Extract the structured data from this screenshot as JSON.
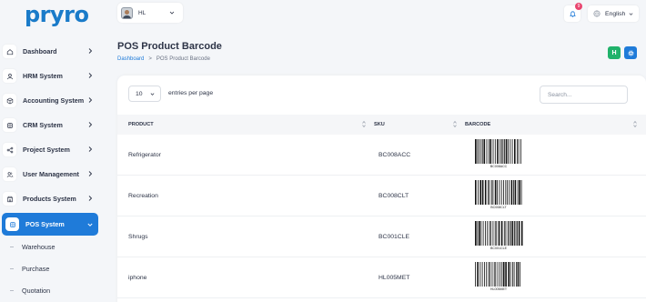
{
  "app": {
    "logo": "pryro"
  },
  "sidebar": {
    "items": [
      {
        "label": "Dashboard",
        "icon": "home-icon"
      },
      {
        "label": "HRM System",
        "icon": "user-icon"
      },
      {
        "label": "Accounting System",
        "icon": "box-icon"
      },
      {
        "label": "CRM System",
        "icon": "layers-icon"
      },
      {
        "label": "Project System",
        "icon": "share-icon"
      },
      {
        "label": "User Management",
        "icon": "users-icon"
      },
      {
        "label": "Products System",
        "icon": "store-icon"
      },
      {
        "label": "POS System",
        "icon": "layers-icon",
        "active": true
      }
    ],
    "subitems": [
      {
        "label": "Warehouse"
      },
      {
        "label": "Purchase"
      },
      {
        "label": "Quotation"
      }
    ]
  },
  "topbar": {
    "user_name": "HL",
    "notification_count": "9",
    "language": "English"
  },
  "header": {
    "title": "POS Product Barcode",
    "breadcrumb": {
      "home": "Dashboard",
      "separator": ">",
      "current": "POS Product Barcode"
    },
    "buttons": {
      "h_label": "H"
    }
  },
  "table": {
    "per_page_value": "10",
    "per_page_label": "entries per page",
    "search_placeholder": "Search...",
    "columns": [
      "PRODUCT",
      "SKU",
      "BARCODE"
    ],
    "rows": [
      {
        "product": "Refrigerator",
        "sku": "BC008ACC",
        "barcode_text": "BC008ACC"
      },
      {
        "product": "Recreation",
        "sku": "BC008CLT",
        "barcode_text": "BC008CLT"
      },
      {
        "product": "Shrugs",
        "sku": "BC001CLE",
        "barcode_text": "BC001CLE"
      },
      {
        "product": "iphone",
        "sku": "HL005MET",
        "barcode_text": "HL005MET"
      }
    ]
  },
  "colors": {
    "primary": "#1f7bd9",
    "success": "#20b26b",
    "badge": "#e9456f"
  }
}
